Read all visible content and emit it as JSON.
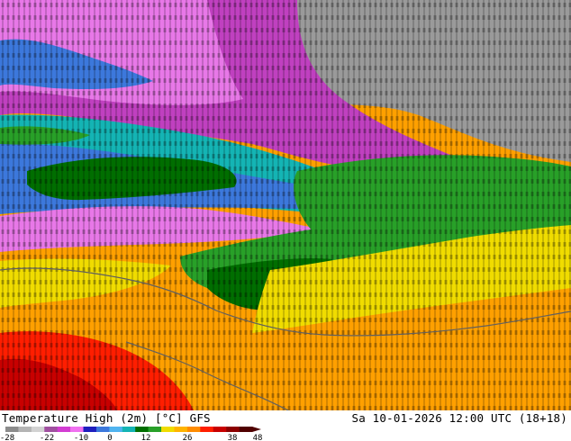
{
  "footer": {
    "title": "Temperature High (2m) [°C] GFS",
    "datetime": "Sa 10-01-2026 12:00 UTC (18+18)"
  },
  "legend": {
    "ticks": [
      "-28",
      "-22",
      "-10",
      "0",
      "12",
      "26",
      "38",
      "48"
    ],
    "colors": [
      "#8c8c8c",
      "#b4b4b4",
      "#d2d2d2",
      "#a050a0",
      "#d23cd2",
      "#f070f0",
      "#1e1ebe",
      "#3c78dc",
      "#50b4f0",
      "#14b4b4",
      "#006e00",
      "#28a028",
      "#f0dc00",
      "#ffb400",
      "#ff8c00",
      "#ff1e00",
      "#c80000",
      "#8c0000",
      "#500000"
    ]
  },
  "map": {
    "zone_colors": {
      "grey": "#9a9a9a",
      "magenta": "#c040c0",
      "pink": "#e878e8",
      "blue": "#3c78dc",
      "cyan": "#14b4b4",
      "green": "#28a028",
      "dark_green": "#006e00",
      "yellow": "#f0dc00",
      "orange": "#ffa000",
      "red": "#ff1e00"
    }
  }
}
